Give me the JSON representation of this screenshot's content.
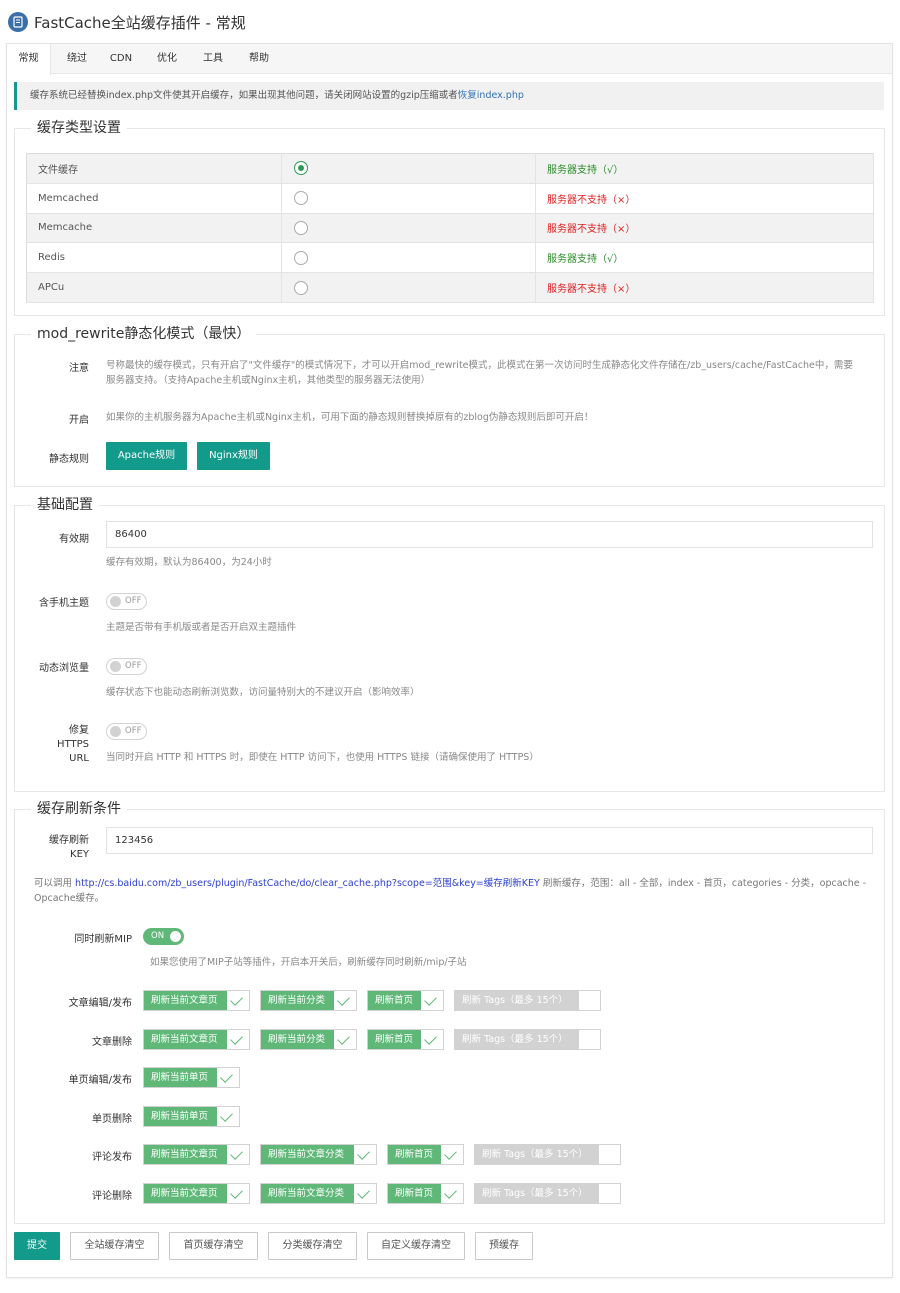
{
  "header": {
    "title": "FastCache全站缓存插件 - 常规"
  },
  "tabs": [
    "常规",
    "绕过",
    "CDN",
    "优化",
    "工具",
    "帮助"
  ],
  "notice": {
    "text": "缓存系统已经替换index.php文件使其开启缓存，如果出现其他问题，请关闭网站设置的gzip压缩或者",
    "link": "恢复index.php"
  },
  "cache_type": {
    "legend": "缓存类型设置",
    "rows": [
      {
        "name": "文件缓存",
        "checked": true,
        "status": "服务器支持（√）",
        "supported": true
      },
      {
        "name": "Memcached",
        "checked": false,
        "status": "服务器不支持（×）",
        "supported": false
      },
      {
        "name": "Memcache",
        "checked": false,
        "status": "服务器不支持（×）",
        "supported": false
      },
      {
        "name": "Redis",
        "checked": false,
        "status": "服务器支持（√）",
        "supported": true
      },
      {
        "name": "APCu",
        "checked": false,
        "status": "服务器不支持（×）",
        "supported": false
      }
    ]
  },
  "rewrite": {
    "legend": "mod_rewrite静态化模式（最快）",
    "note_label": "注意",
    "note_text": "号称最快的缓存模式，只有开启了\"文件缓存\"的模式情况下，才可以开启mod_rewrite模式，此模式在第一次访问时生成静态化文件存储在/zb_users/cache/FastCache中，需要服务器支持。（支持Apache主机或Nginx主机，其他类型的服务器无法使用）",
    "enable_label": "开启",
    "enable_text": "如果你的主机服务器为Apache主机或Nginx主机，可用下面的静态规则替换掉原有的zblog伪静态规则后即可开启！",
    "rules_label": "静态规则",
    "apache_btn": "Apache规则",
    "nginx_btn": "Nginx规则"
  },
  "basic": {
    "legend": "基础配置",
    "expire_label": "有效期",
    "expire_value": "86400",
    "expire_desc": "缓存有效期，默认为86400，为24小时",
    "mobile_label": "含手机主题",
    "mobile_state": "OFF",
    "mobile_desc": "主题是否带有手机版或者是否开启双主题插件",
    "dynamic_label": "动态浏览量",
    "dynamic_state": "OFF",
    "dynamic_desc": "缓存状态下也能动态刷新浏览数，访问量特别大的不建议开启（影响效率）",
    "https_label_1": "修复",
    "https_label_2": "HTTPS",
    "https_label_3": "URL",
    "https_state": "OFF",
    "https_desc": "当同时开启 HTTP 和 HTTPS 时，即使在 HTTP 访问下，也使用 HTTPS 链接（请确保使用了 HTTPS）"
  },
  "refresh": {
    "legend": "缓存刷新条件",
    "key_label_1": "缓存刷新",
    "key_label_2": "KEY",
    "key_value": "123456",
    "tip_prefix": "可以调用",
    "tip_link": "http://cs.baidu.com/zb_users/plugin/FastCache/do/clear_cache.php?scope=范围&key=缓存刷新KEY",
    "tip_suffix": "刷新缓存，范围：all - 全部，index - 首页，categories - 分类，opcache - Opcache缓存。",
    "mip_label": "同时刷新MIP",
    "mip_state": "ON",
    "mip_desc": "如果您使用了MIP子站等插件，开启本开关后，刷新缓存同时刷新/mip/子站",
    "rows": [
      {
        "label": "文章编辑/发布",
        "items": [
          {
            "text": "刷新当前文章页",
            "on": true
          },
          {
            "text": "刷新当前分类",
            "on": true
          },
          {
            "text": "刷新首页",
            "on": true
          },
          {
            "text": "刷新 Tags（最多 15个）",
            "on": false
          }
        ]
      },
      {
        "label": "文章删除",
        "items": [
          {
            "text": "刷新当前文章页",
            "on": true
          },
          {
            "text": "刷新当前分类",
            "on": true
          },
          {
            "text": "刷新首页",
            "on": true
          },
          {
            "text": "刷新 Tags（最多 15个）",
            "on": false
          }
        ]
      },
      {
        "label": "单页编辑/发布",
        "items": [
          {
            "text": "刷新当前单页",
            "on": true
          }
        ]
      },
      {
        "label": "单页删除",
        "items": [
          {
            "text": "刷新当前单页",
            "on": true
          }
        ]
      },
      {
        "label": "评论发布",
        "items": [
          {
            "text": "刷新当前文章页",
            "on": true
          },
          {
            "text": "刷新当前文章分类",
            "on": true
          },
          {
            "text": "刷新首页",
            "on": true
          },
          {
            "text": "刷新 Tags（最多 15个）",
            "on": false
          }
        ]
      },
      {
        "label": "评论删除",
        "items": [
          {
            "text": "刷新当前文章页",
            "on": true
          },
          {
            "text": "刷新当前文章分类",
            "on": true
          },
          {
            "text": "刷新首页",
            "on": true
          },
          {
            "text": "刷新 Tags（最多 15个）",
            "on": false
          }
        ]
      }
    ]
  },
  "footer": {
    "submit": "提交",
    "clear_all": "全站缓存清空",
    "clear_home": "首页缓存清空",
    "clear_category": "分类缓存清空",
    "clear_custom": "自定义缓存清空",
    "precache": "预缓存"
  },
  "colors": {
    "accent": "#129a8a",
    "switch_on": "#5fb878",
    "ok": "#2a8c2a",
    "error": "#e02020",
    "link": "#3671b8"
  }
}
